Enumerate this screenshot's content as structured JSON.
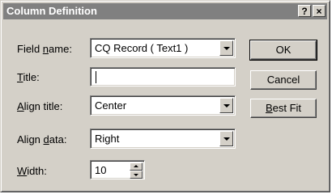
{
  "dialog": {
    "title": "Column Definition",
    "help_label": "?",
    "close_label": "×"
  },
  "fields": {
    "field_name": {
      "label_pre": "Field ",
      "label_key": "n",
      "label_post": "ame:",
      "value": "CQ Record ( Text1 )"
    },
    "title": {
      "label_pre": "",
      "label_key": "T",
      "label_post": "itle:",
      "value": ""
    },
    "align_title": {
      "label_pre": "",
      "label_key": "A",
      "label_post": "lign title:",
      "value": "Center"
    },
    "align_data": {
      "label_pre": "Align ",
      "label_key": "d",
      "label_post": "ata:",
      "value": "Right"
    },
    "width": {
      "label_pre": "",
      "label_key": "W",
      "label_post": "idth:",
      "value": "10"
    }
  },
  "buttons": {
    "ok": "OK",
    "cancel": "Cancel",
    "best_fit_key": "B",
    "best_fit_rest": "est Fit"
  }
}
